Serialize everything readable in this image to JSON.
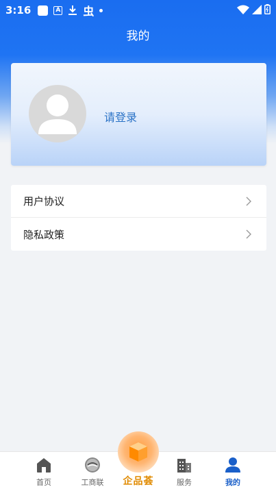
{
  "status_bar": {
    "time": "3:16",
    "icons": [
      "square-app-icon",
      "a-box-icon",
      "download-icon",
      "bug-icon",
      "dot-icon",
      "wifi-icon",
      "signal-icon",
      "battery-icon"
    ],
    "bug_glyph": "虫",
    "a_glyph": "A"
  },
  "header": {
    "title": "我的"
  },
  "profile": {
    "login_text": "请登录",
    "avatar_icon": "default-avatar-icon"
  },
  "menu": {
    "items": [
      {
        "label": "用户协议",
        "icon": "chevron-right-icon"
      },
      {
        "label": "隐私政策",
        "icon": "chevron-right-icon"
      }
    ]
  },
  "bottom_nav": {
    "items": [
      {
        "label": "首页",
        "icon": "home-icon",
        "active": false
      },
      {
        "label": "工商联",
        "icon": "federation-logo-icon",
        "active": false
      },
      {
        "label": "企品荟",
        "icon": "box-icon",
        "active": false,
        "featured": true
      },
      {
        "label": "服务",
        "icon": "building-icon",
        "active": false
      },
      {
        "label": "我的",
        "icon": "user-icon",
        "active": true
      }
    ]
  },
  "colors": {
    "header_blue": "#1a6df0",
    "login_text": "#2a72c6",
    "active_tab": "#1a5fc9",
    "featured_orange": "#ff9e3d"
  }
}
